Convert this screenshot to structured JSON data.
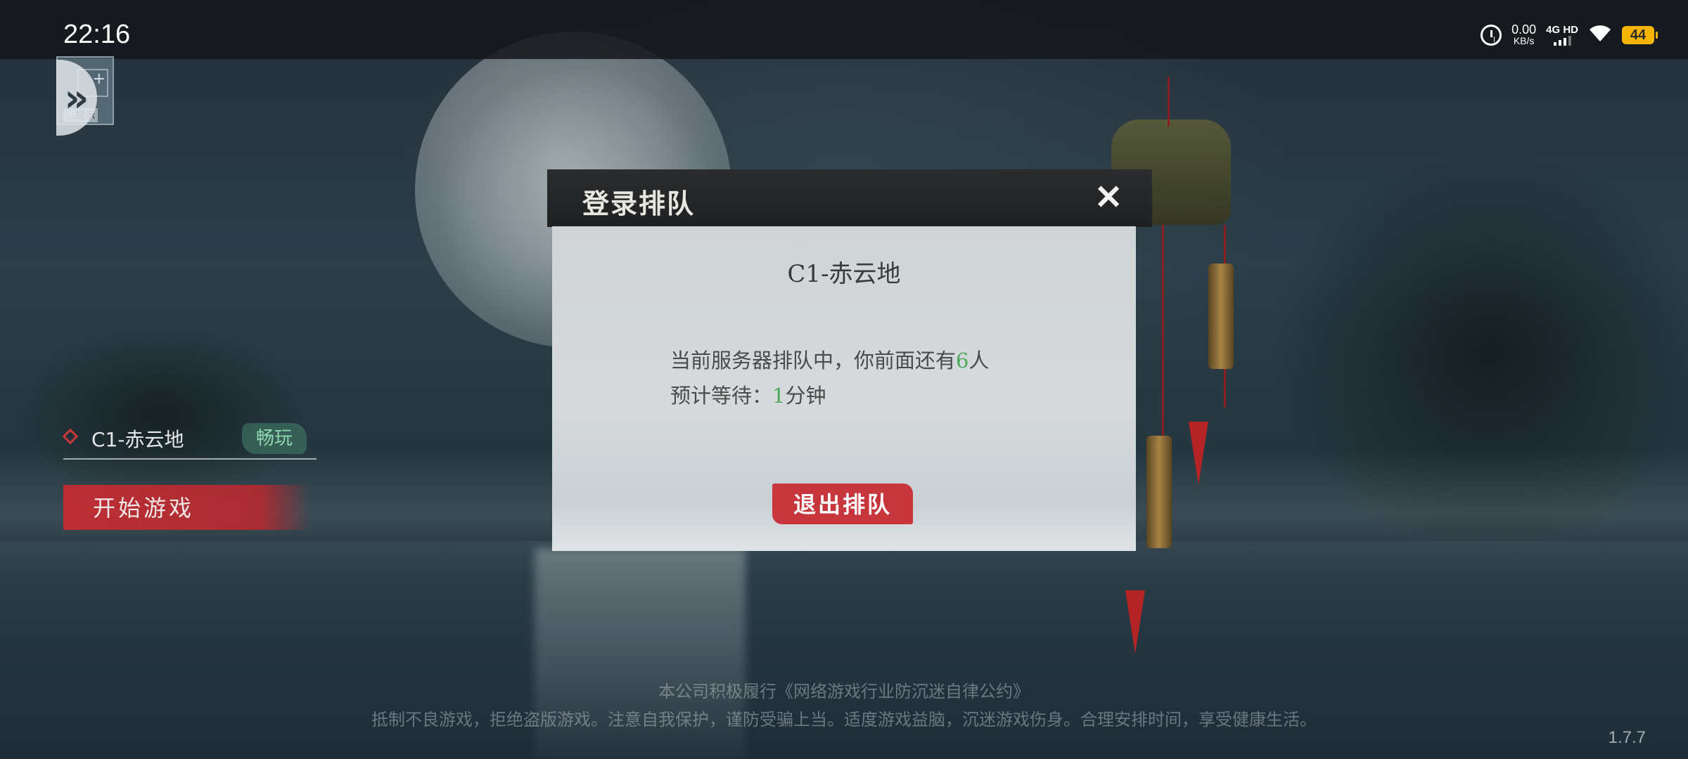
{
  "status_bar": {
    "time": "22:16",
    "net_speed_value": "0.00",
    "net_speed_unit": "KB/s",
    "network_type": "4G HD",
    "battery": "44",
    "icons": [
      "alarm-icon",
      "signal-icon",
      "wifi-icon",
      "battery-icon"
    ]
  },
  "floating_widget": {
    "label": "...提示",
    "badge": "+",
    "arrow": "»"
  },
  "server_select": {
    "name": "C1-赤云地",
    "tag": "畅玩"
  },
  "start_button": {
    "label": "开始游戏"
  },
  "dialog": {
    "title": "登录排队",
    "close_symbol": "✕",
    "server": "C1-赤云地",
    "queue_text_prefix": "当前服务器排队中，你前面还有",
    "queue_count": "6",
    "queue_text_suffix": "人",
    "wait_prefix": "预计等待：",
    "wait_minutes": "1",
    "wait_suffix": "分钟",
    "exit_button": "退出排队"
  },
  "footer": {
    "line1": "本公司积极履行《网络游戏行业防沉迷自律公约》",
    "line2": "抵制不良游戏，拒绝盗版游戏。注意自我保护，谨防受骗上当。适度游戏益脑，沉迷游戏伤身。合理安排时间，享受健康生活。",
    "version": "1.7.7"
  },
  "colors": {
    "accent_red": "#c7363d",
    "highlight_green": "#4ea85a",
    "tag_green": "#8fd6b0"
  }
}
